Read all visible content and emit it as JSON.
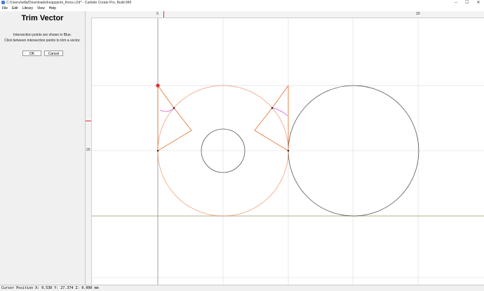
{
  "window": {
    "title": "C:/Users/willa/Downloads/knappjoint_thrice.c2d* - Carbide Create Pro, Build 845",
    "controls": [
      "–",
      "☐",
      "✕"
    ]
  },
  "menu": [
    "File",
    "Edit",
    "Library",
    "View",
    "Help"
  ],
  "panel": {
    "title": "Trim Vector",
    "instruction_1": "Intersection points are shown in Blue.",
    "instruction_2": "Click between intersection points to trim a vector.",
    "ok_label": "OK",
    "cancel_label": "Cancel"
  },
  "rulers": {
    "top_labels": [
      "0",
      "20"
    ],
    "left_labels": [
      "20"
    ]
  },
  "status": {
    "text": "Cursor Position X: 0.530 Y: 27.374 Z: 0.000 mm"
  },
  "colors": {
    "selected_vector": "#e8773a",
    "unselected_vector": "#555555",
    "intersection_marker": "#e070e0",
    "grid": "#d9d9d9",
    "stock_outline": "#a39a6c"
  }
}
